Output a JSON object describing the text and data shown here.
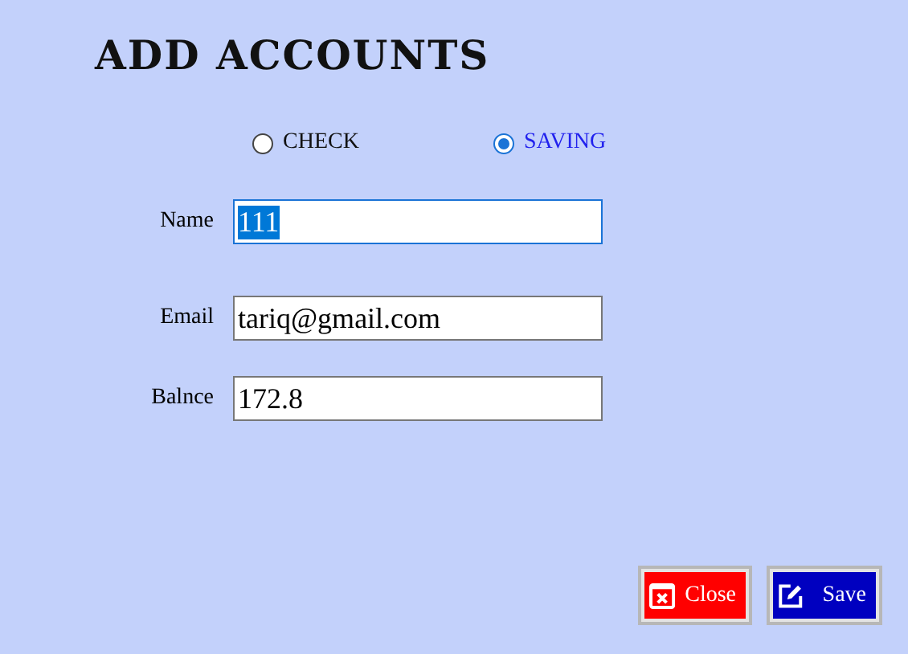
{
  "title": "ADD ACCOUNTS",
  "account_types": [
    {
      "label": "CHECK",
      "selected": false
    },
    {
      "label": "SAVING",
      "selected": true
    }
  ],
  "fields": [
    {
      "label": "Name",
      "value": "111",
      "focused": true
    },
    {
      "label": "Email",
      "value": "tariq@gmail.com",
      "focused": false
    },
    {
      "label": "Balnce",
      "value": "172.8",
      "focused": false
    }
  ],
  "buttons": [
    {
      "label": "Close",
      "kind": "close"
    },
    {
      "label": "Save",
      "kind": "save"
    }
  ]
}
